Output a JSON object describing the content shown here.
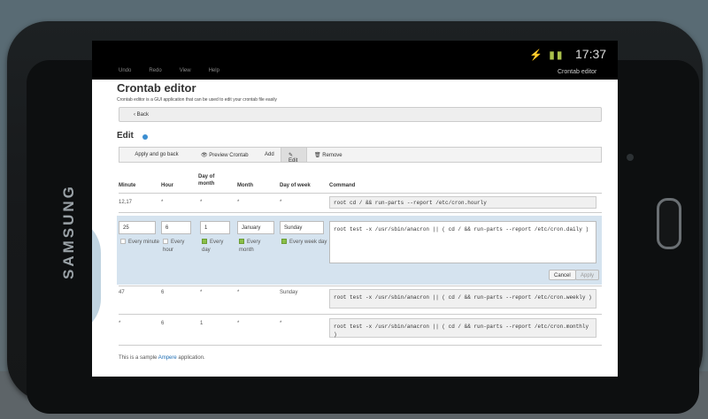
{
  "device": {
    "brand": "SAMSUNG"
  },
  "status_bar": {
    "time": "17:37",
    "icons": "⚡ ▮▮",
    "menu": [
      "Undo",
      "Redo",
      "View",
      "Help"
    ],
    "app_title": "Crontab editor"
  },
  "page": {
    "title": "Crontab editor",
    "subtitle": "Crontab editor is a GUI application that can be used to edit your crontab file easily",
    "back_label": "‹ Back",
    "section_title": "Edit"
  },
  "toolbar": {
    "apply_label": "Apply and go back",
    "preview_label": "👁 Preview Crontab",
    "add_label": "Add",
    "edit_label": "✎ Edit",
    "remove_label": "🗑 Remove"
  },
  "table": {
    "headers": [
      "Minute",
      "Hour",
      "Day of month",
      "Month",
      "Day of week",
      "Command"
    ],
    "rows": [
      {
        "minute": "12,17",
        "hour": "*",
        "dom": "*",
        "month": "*",
        "dow": "*",
        "command": "root    cd / && run-parts --report /etc/cron.hourly"
      },
      {
        "minute": "47",
        "hour": "6",
        "dom": "*",
        "month": "*",
        "dow": "Sunday",
        "command": "root    test -x /usr/sbin/anacron || ( cd / && run-parts --report /etc/cron.weekly )"
      },
      {
        "minute": "*",
        "hour": "6",
        "dom": "1",
        "month": "*",
        "dow": "*",
        "command": "root    test -x /usr/sbin/anacron || ( cd / && run-parts --report /etc/cron.monthly )"
      }
    ]
  },
  "edit_row": {
    "minute": "25",
    "hour": "6",
    "dom": "1",
    "month": "January",
    "dow": "Sunday",
    "command": "root    test -x /usr/sbin/anacron || ( cd / && run-parts --report /etc/cron.daily )",
    "every_minute": "Every minute",
    "every_hour": "Every hour",
    "every_day": "Every day",
    "every_month": "Every month",
    "every_week_day": "Every week day",
    "cancel_label": "Cancel",
    "apply_label": "Apply"
  },
  "footer": {
    "text_before": "This is a sample ",
    "link": "Ampere",
    "text_after": " application."
  }
}
